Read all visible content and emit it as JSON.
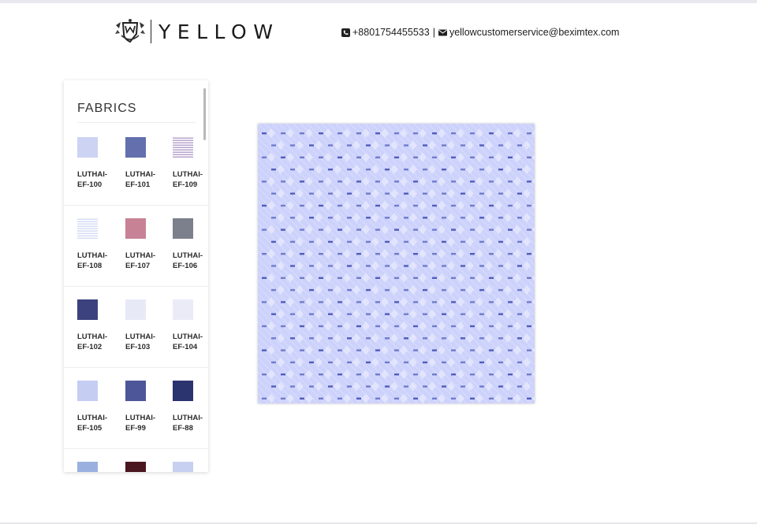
{
  "header": {
    "brand": "YELLOW",
    "logo_icon": "crest-logo-icon",
    "phone": "+8801754455533",
    "separator": "|",
    "email": "yellowcustomerservice@beximtex.com",
    "phone_icon": "phone-square-icon",
    "email_icon": "envelope-icon"
  },
  "panel": {
    "title": "FABRICS",
    "rows": [
      {
        "items": [
          {
            "line1": "LUTHAI-",
            "line2": "EF-100",
            "color": "#cdd3f3",
            "pattern": "plain"
          },
          {
            "line1": "LUTHAI-",
            "line2": "EF-101",
            "color": "#6470ad",
            "pattern": "plain"
          },
          {
            "line1": "LUTHAI-",
            "line2": "EF-109",
            "color": "#b7a4cc",
            "pattern": "stripe"
          }
        ]
      },
      {
        "items": [
          {
            "line1": "LUTHAI-",
            "line2": "EF-108",
            "color": "#d6dcf5",
            "pattern": "stripe"
          },
          {
            "line1": "LUTHAI-",
            "line2": "EF-107",
            "color": "#c78395",
            "pattern": "plain"
          },
          {
            "line1": "LUTHAI-",
            "line2": "EF-106",
            "color": "#7c7f8c",
            "pattern": "plain"
          }
        ]
      },
      {
        "items": [
          {
            "line1": "LUTHAI-",
            "line2": "EF-102",
            "color": "#3c427d",
            "pattern": "plain"
          },
          {
            "line1": "LUTHAI-",
            "line2": "EF-103",
            "color": "#e8e9f7",
            "pattern": "plain"
          },
          {
            "line1": "LUTHAI-",
            "line2": "EF-104",
            "color": "#ebebf8",
            "pattern": "plain"
          }
        ]
      },
      {
        "items": [
          {
            "line1": "LUTHAI-",
            "line2": "EF-105",
            "color": "#c5cdf2",
            "pattern": "plain"
          },
          {
            "line1": "LUTHAI-",
            "line2": "EF-99",
            "color": "#4d5699",
            "pattern": "plain"
          },
          {
            "line1": "LUTHAI-",
            "line2": "EF-88",
            "color": "#2c3470",
            "pattern": "plain"
          }
        ]
      },
      {
        "items": [
          {
            "line1": "",
            "line2": "",
            "color": "#9ab0de",
            "pattern": "plain"
          },
          {
            "line1": "",
            "line2": "",
            "color": "#4a1620",
            "pattern": "plain"
          },
          {
            "line1": "",
            "line2": "",
            "color": "#c7d0f0",
            "pattern": "plain"
          }
        ]
      }
    ]
  },
  "preview": {
    "base_color": "#ccd2fb",
    "dash_color": "#4a55b8",
    "highlight_color": "#f2f3ff"
  }
}
